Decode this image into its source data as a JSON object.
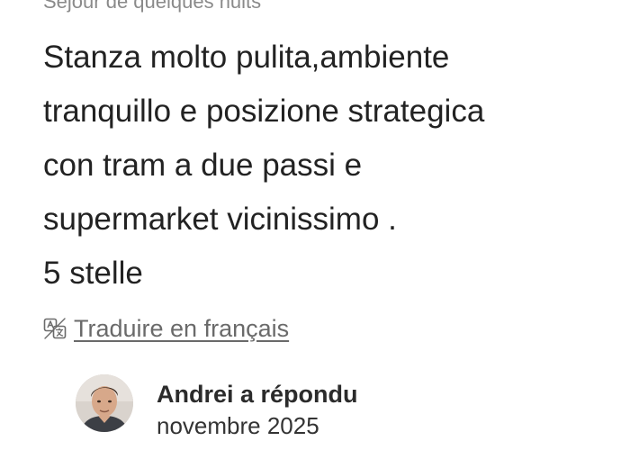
{
  "review": {
    "stay_type": "Séjour de quelques nuits",
    "lines": [
      "Stanza molto pulita,ambiente",
      "tranquillo e posizione strategica",
      "con tram a due passi e",
      "supermarket vicinissimo .",
      "5 stelle"
    ],
    "translate_icon": "translate-icon",
    "translate_label": "Traduire en français"
  },
  "host_reply": {
    "avatar_icon": "host-avatar",
    "author_label": "Andrei a répondu",
    "date": "novembre 2025"
  }
}
